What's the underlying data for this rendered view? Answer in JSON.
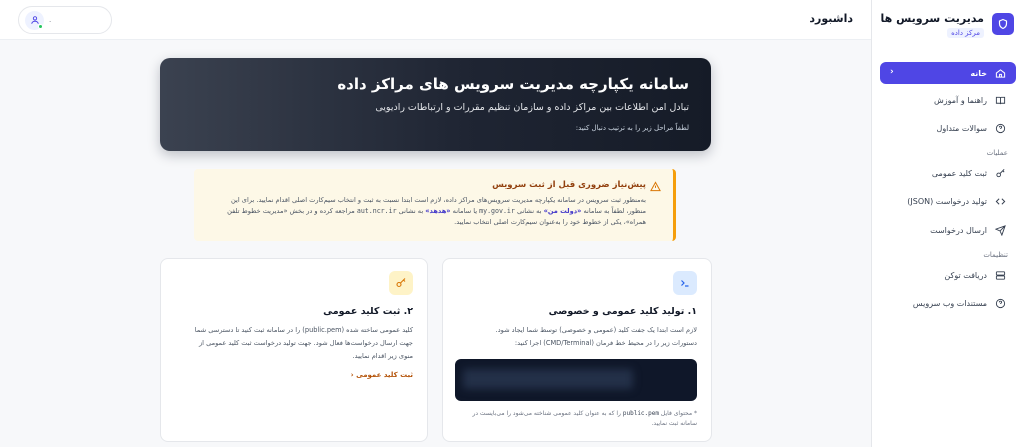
{
  "sidebar": {
    "brand": {
      "title": "مدیریت سرویس ها",
      "badge": "مرکز داده"
    },
    "items": [
      {
        "label": "خانه",
        "icon": "home-icon",
        "active": true
      },
      {
        "label": "راهنما و آموزش",
        "icon": "book-icon"
      },
      {
        "label": "سوالات متداول",
        "icon": "help-circle-icon"
      }
    ],
    "section_operations": "عملیات",
    "operations": [
      {
        "label": "ثبت کلید عمومی",
        "icon": "key-icon"
      },
      {
        "label": "تولید درخواست (JSON)",
        "icon": "code-icon"
      },
      {
        "label": "ارسال درخواست",
        "icon": "send-icon"
      }
    ],
    "section_settings": "تنظیمات",
    "settings": [
      {
        "label": "دریافت توکن",
        "icon": "server-icon"
      },
      {
        "label": "مستندات وب سرویس",
        "icon": "help-circle-icon"
      }
    ]
  },
  "header": {
    "title": "داشبورد",
    "user_name": "."
  },
  "hero": {
    "title": "سامانه یکپارچه مدیریت سرویس های مراکز داده",
    "subtitle": "تبادل امن اطلاعات بین مراکز داده و سازمان تنظیم مقررات و ارتباطات رادیویی",
    "note": "لطفاً مراحل زیر را به ترتیب دنبال کنید:"
  },
  "alert": {
    "title": "پیش‌نیاز ضروری قبل از ثبت سرویس",
    "line1": "به‌منظور ثبت سرویس در سامانه یکپارچه مدیریت سرویس‌های مراکز داده، لازم است ابتدا نسبت به ثبت و انتخاب سیم‌کارت اصلی اقدام نمایید. برای این",
    "line2_a": "منظور، لطفاً به سامانه ",
    "link1": "«دولت من»",
    "line2_b": " به نشانی ",
    "domain1": "my.gov.ir",
    "line2_c": " یا سامانه ",
    "link2": "«هدهد»",
    "line2_d": " به نشانی ",
    "domain2": "aut.ncr.ir",
    "line2_e": " مراجعه کرده و در بخش «مدیریت خطوط تلفن",
    "line3": "همراه»، یکی از خطوط خود را به‌عنوان سیم‌کارت اصلی انتخاب نمایید."
  },
  "card_step1": {
    "title": "۱. تولید کلید عمومی و خصوصی",
    "body1": "لازم است ابتدا یک جفت کلید (عمومی و خصوصی) توسط شما ایجاد شود.",
    "body2": "دستورات زیر را در محیط خط فرمان (CMD/Terminal) اجرا کنید:",
    "foot_a": "* محتوای فایل ",
    "foot_file": "public.pem",
    "foot_b": " را که به عنوان کلید عمومی شناخته می‌شود را می‌بایست در",
    "foot_c": "سامانه ثبت نمایید."
  },
  "card_step2": {
    "title": "۲. ثبت کلید عمومی",
    "body1": "کلید عمومی ساخته شده (public.pem) را در سامانه ثبت کنید تا دسترسی شما",
    "body2": "جهت ارسال درخواست‌ها فعال شود. جهت تولید درخواست ثبت کلید عمومی از",
    "body3": "منوی زیر اقدام نمایید.",
    "link": "ثبت کلید عمومی"
  },
  "colors": {
    "accent": "#4f46e5",
    "warning": "#f59e0b",
    "hero_dark": "#1f2533"
  }
}
